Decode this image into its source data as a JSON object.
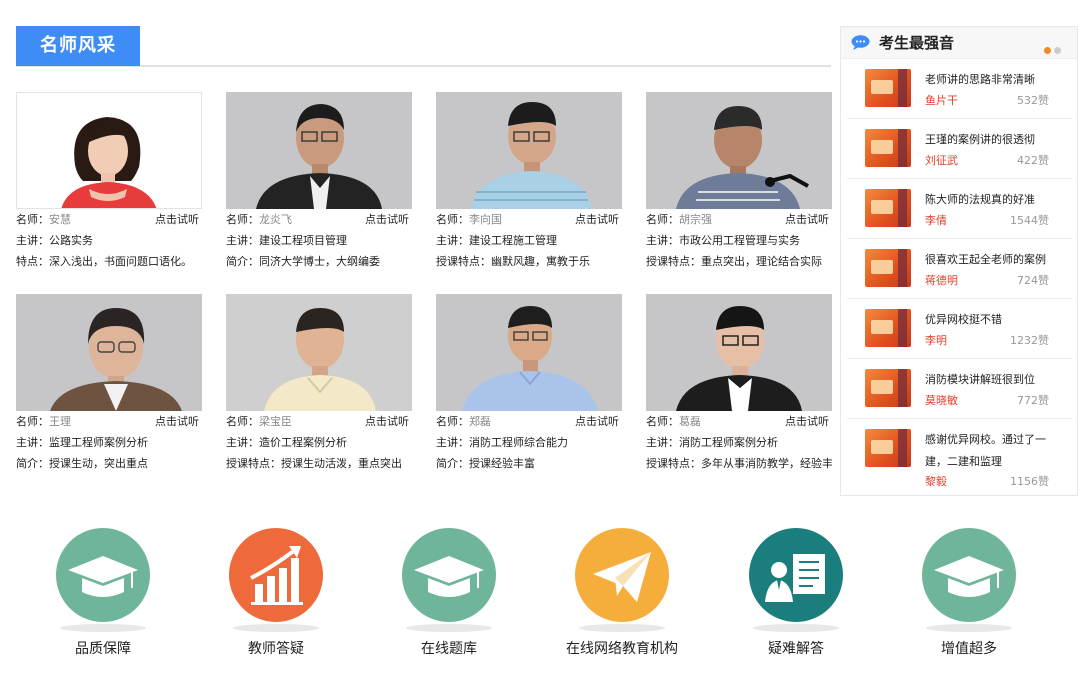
{
  "section": {
    "title": "名师风采"
  },
  "teachers": [
    {
      "name_label": "名师：",
      "name": "安慧",
      "try_label": "点击试听",
      "line2": "主讲：公路实务",
      "line3": "特点：深入浅出，书面问题口语化。"
    },
    {
      "name_label": "名师：",
      "name": "龙炎飞",
      "try_label": "点击试听",
      "line2": "主讲：建设工程项目管理",
      "line3": "简介：同济大学博士，大纲编委"
    },
    {
      "name_label": "名师：",
      "name": "李向国",
      "try_label": "点击试听",
      "line2": "主讲：建设工程施工管理",
      "line3": "授课特点：幽默风趣，寓教于乐"
    },
    {
      "name_label": "名师：",
      "name": "胡宗强",
      "try_label": "点击试听",
      "line2": "主讲：市政公用工程管理与实务",
      "line3": "授课特点：重点突出，理论结合实际"
    },
    {
      "name_label": "名师：",
      "name": "王理",
      "try_label": "点击试听",
      "line2": "主讲：监理工程师案例分析",
      "line3": "简介：授课生动，突出重点"
    },
    {
      "name_label": "名师：",
      "name": "梁宝臣",
      "try_label": "点击试听",
      "line2": "主讲：造价工程案例分析",
      "line3": "授课特点：授课生动活泼，重点突出"
    },
    {
      "name_label": "名师：",
      "name": "郑磊",
      "try_label": "点击试听",
      "line2": "主讲：消防工程师综合能力",
      "line3": "简介：授课经验丰富"
    },
    {
      "name_label": "名师：",
      "name": "葛磊",
      "try_label": "点击试听",
      "line2": "主讲：消防工程师案例分析",
      "line3": "授课特点：多年从事消防教学，经验丰"
    }
  ],
  "side": {
    "title": "考生最强音",
    "colors": {
      "dot_active": "#f08a24",
      "dot_inactive": "#cccccc"
    },
    "items": [
      {
        "text": "老师讲的思路非常清晰",
        "user": "鱼片干",
        "likes": "532赞"
      },
      {
        "text": "王瑾的案例讲的很透彻",
        "user": "刘征武",
        "likes": "422赞"
      },
      {
        "text": "陈大师的法规真的好准",
        "user": "李倩",
        "likes": "1544赞"
      },
      {
        "text": "很喜欢王起全老师的案例",
        "user": "蒋德明",
        "likes": "724赞"
      },
      {
        "text": "优异网校挺不错",
        "user": "李明",
        "likes": "1232赞"
      },
      {
        "text": "消防模块讲解班很到位",
        "user": "莫晓敏",
        "likes": "772赞"
      },
      {
        "text": "感谢优异网校。通过了一建，二建和监理",
        "user": "黎毅",
        "likes": "1156赞"
      }
    ]
  },
  "features": [
    {
      "label": "品质保障",
      "icon": "graduation-cap-icon",
      "color": "#6fb59a"
    },
    {
      "label": "教师答疑",
      "icon": "growth-chart-icon",
      "color": "#ee6a3a"
    },
    {
      "label": "在线题库",
      "icon": "graduation-cap-icon",
      "color": "#6fb59a"
    },
    {
      "label": "在线网络教育机构",
      "icon": "paper-plane-icon",
      "color": "#f5ae3b"
    },
    {
      "label": "疑难解答",
      "icon": "teacher-board-icon",
      "color": "#1a7f7c"
    },
    {
      "label": "增值超多",
      "icon": "graduation-cap-icon",
      "color": "#6fb59a"
    }
  ]
}
